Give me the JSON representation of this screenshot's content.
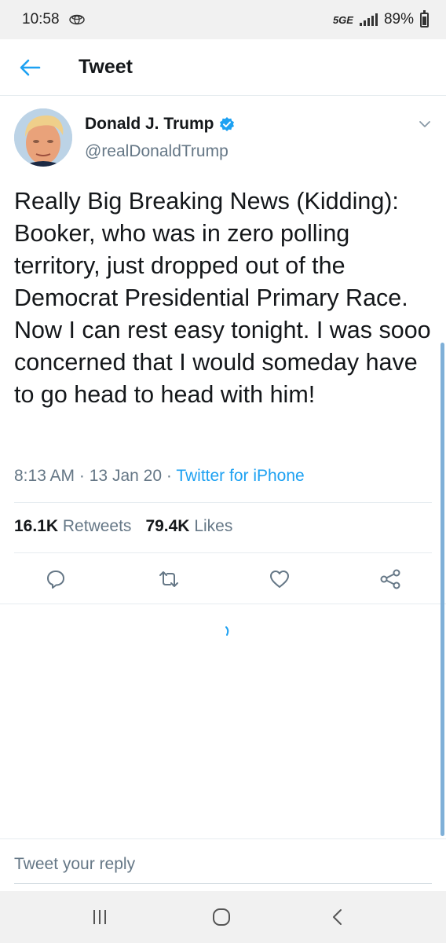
{
  "status_bar": {
    "time": "10:58",
    "network": "5GE",
    "battery": "89%",
    "icons": [
      "car-icon",
      "signal-icon",
      "battery-icon"
    ]
  },
  "header": {
    "title": "Tweet",
    "back_icon": "arrow-left-icon"
  },
  "tweet": {
    "author_name": "Donald J. Trump",
    "handle": "@realDonaldTrump",
    "verified": true,
    "text": "Really Big Breaking News (Kidding): Booker, who was in zero polling territory, just dropped out of the Democrat Presidential Primary Race. Now I can rest easy tonight. I was sooo concerned that I would someday have to go head to head with him!",
    "time": "8:13 AM",
    "separator": "·",
    "date": "13 Jan 20",
    "source": "Twitter for iPhone",
    "retweets_count": "16.1K",
    "retweets_label": "Retweets",
    "likes_count": "79.4K",
    "likes_label": "Likes"
  },
  "actions": [
    "reply-icon",
    "retweet-icon",
    "like-icon",
    "share-icon"
  ],
  "reply": {
    "placeholder": "Tweet your reply"
  },
  "navigation": [
    "recent-apps-icon",
    "home-icon",
    "back-icon"
  ],
  "colors": {
    "accent": "#1da1f2",
    "secondary_text": "#657786",
    "primary_text": "#14171a",
    "divider": "#e6ecf0"
  }
}
